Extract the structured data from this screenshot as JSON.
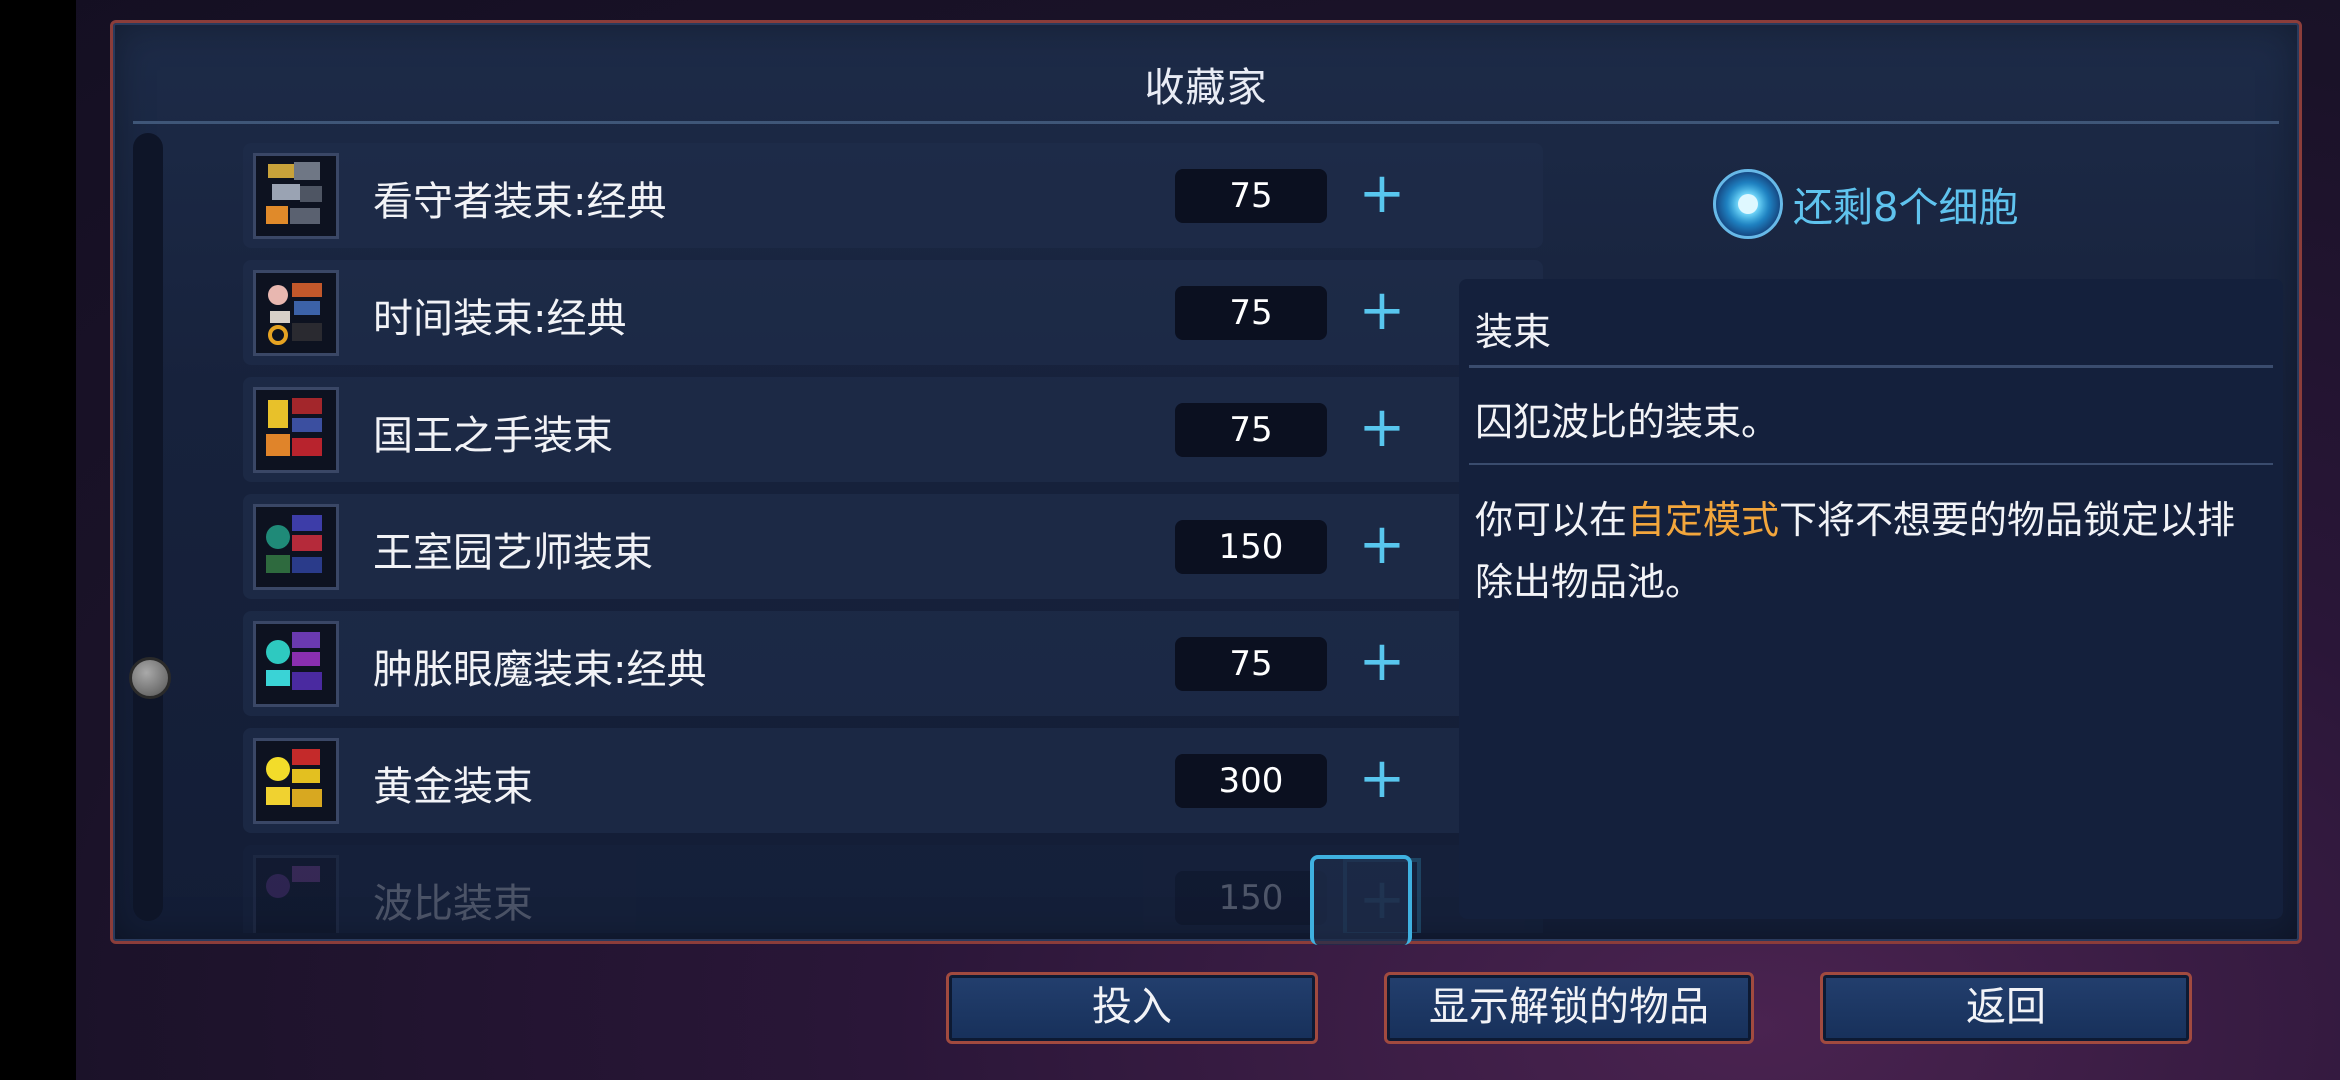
{
  "panel": {
    "title": "收藏家"
  },
  "items": [
    {
      "name": "看守者装束:经典",
      "cost": "75",
      "plus": "+"
    },
    {
      "name": "时间装束:经典",
      "cost": "75",
      "plus": "+"
    },
    {
      "name": "国王之手装束",
      "cost": "75",
      "plus": "+"
    },
    {
      "name": "王室园艺师装束",
      "cost": "150",
      "plus": "+"
    },
    {
      "name": "肿胀眼魔装束:经典",
      "cost": "75",
      "plus": "+"
    },
    {
      "name": "黄金装束",
      "cost": "300",
      "plus": "+"
    },
    {
      "name": "波比装束",
      "cost": "150",
      "plus": "+"
    }
  ],
  "cells": {
    "text": "还剩8个细胞",
    "icon": "cell-orb-icon"
  },
  "info": {
    "header": "装束",
    "description": "囚犯波比的装束。",
    "hint_before": "你可以在",
    "hint_highlight": "自定模式",
    "hint_after": "下将不想要的物品锁定以排除出物品池。"
  },
  "buttons": {
    "invest": "投入",
    "show_unlocked": "显示解锁的物品",
    "back": "返回"
  },
  "colors": {
    "accent_blue": "#58c6ee",
    "highlight_orange": "#f3a63c",
    "frame_red": "#8b3d3a"
  }
}
